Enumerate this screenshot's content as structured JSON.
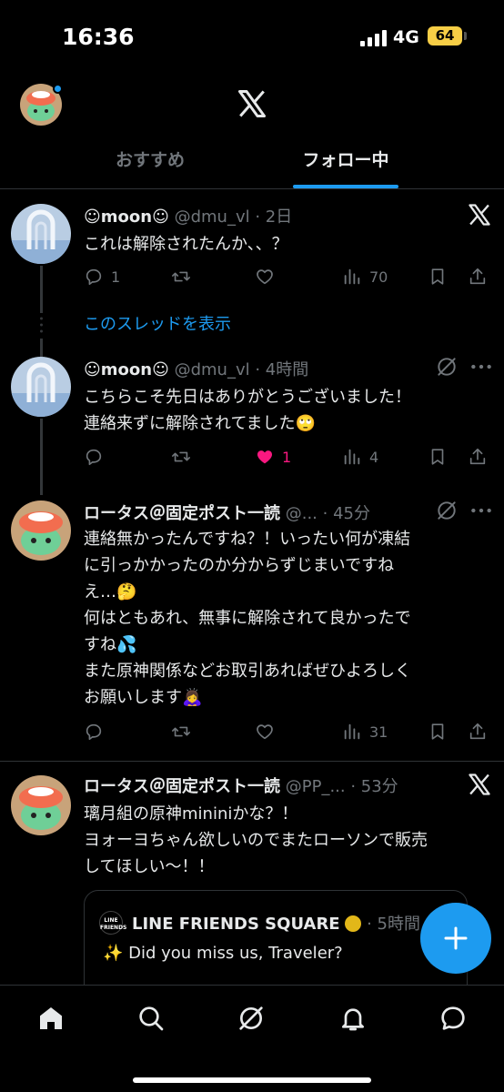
{
  "status_bar": {
    "time": "16:36",
    "network": "4G",
    "battery": "64"
  },
  "header": {
    "logo": "X",
    "tabs": [
      {
        "label": "おすすめ",
        "active": false
      },
      {
        "label": "フォロー中",
        "active": true
      }
    ]
  },
  "tweets": [
    {
      "name": "☺︎moon☺︎",
      "meta": "@dmu_vl · 2日",
      "lines": [
        "これは解除されたんか、、？"
      ],
      "replies": "1",
      "retweets": "",
      "likes": "",
      "views": "70",
      "liked": false
    },
    {
      "name": "☺︎moon☺︎",
      "meta": "@dmu_vl · 4時間",
      "lines": [
        "こちらこそ先日はありがとうございました！",
        "連絡来ずに解除されてました🙄"
      ],
      "replies": "",
      "retweets": "",
      "likes": "1",
      "views": "4",
      "liked": true
    },
    {
      "name": "ロータス＠固定ポスト一読",
      "meta": "@... · 45分",
      "lines": [
        "連絡無かったんですね？！いったい何が凍結",
        "に引っかかったのか分からずじまいですね",
        "え…🤔",
        "何はともあれ、無事に解除されて良かったで",
        "すね💦",
        "また原神関係などお取引あればぜひよろしく",
        "お願いします🙇‍♀️"
      ],
      "replies": "",
      "retweets": "",
      "likes": "",
      "views": "31",
      "liked": false
    },
    {
      "name": "ロータス＠固定ポスト一読",
      "meta": "@PP_... · 53分",
      "lines": [
        "璃月組の原神mininiかな？！",
        "ヨォーヨちゃん欲しいのでまたローソンで販売",
        "してほしい〜！！"
      ]
    }
  ],
  "show_thread": "このスレッドを表示",
  "quote": {
    "logo_text": "LINE FRIENDS",
    "name": "LINE FRIENDS SQUARE",
    "meta": "· 5時間",
    "text": "✨ Did you miss us, Traveler?"
  },
  "colors": {
    "accent": "#1d9bf0",
    "like": "#f91880",
    "muted": "#71767b",
    "background": "#000000"
  },
  "icons": [
    "reply-icon",
    "retweet-icon",
    "like-icon",
    "views-icon",
    "bookmark-icon",
    "share-icon",
    "x-logo-icon",
    "grok-icon",
    "more-icon",
    "home-icon",
    "search-icon",
    "notifications-icon",
    "messages-icon",
    "compose-icon"
  ]
}
